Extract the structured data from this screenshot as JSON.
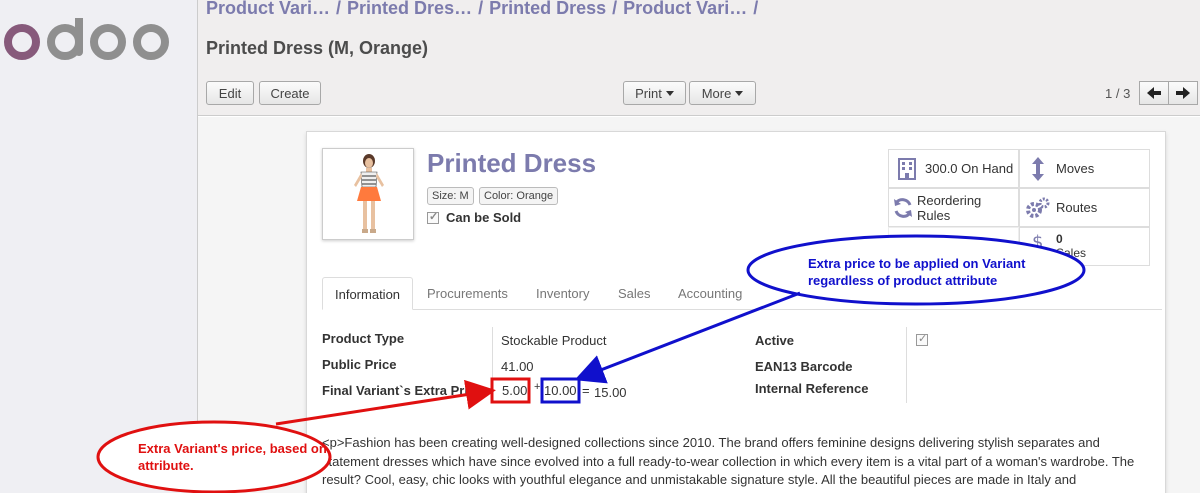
{
  "breadcrumb": [
    "Product Vari…",
    "Printed Dres…",
    "Printed Dress",
    "Product Vari…"
  ],
  "page_title": "Printed Dress (M, Orange)",
  "buttons": {
    "edit": "Edit",
    "create": "Create",
    "print": "Print",
    "more": "More"
  },
  "pager": "1 / 3",
  "product": {
    "name": "Printed Dress",
    "tags": [
      "Size: M",
      "Color: Orange"
    ],
    "can_be_sold": "Can be Sold",
    "can_be_sold_checked": true
  },
  "smart_buttons": {
    "on_hand": "300.0 On Hand",
    "moves": "Moves",
    "reordering": "Reordering Rules",
    "routes": "Routes",
    "sales_count": "0",
    "sales_label": "Sales"
  },
  "tabs": [
    "Information",
    "Procurements",
    "Inventory",
    "Sales",
    "Accounting"
  ],
  "fields": {
    "product_type_label": "Product Type",
    "product_type": "Stockable Product",
    "public_price_label": "Public Price",
    "public_price": "41.00",
    "extra_price_label": "Final Variant`s Extra Price",
    "attr_extra": "5.00",
    "plus": "+",
    "variant_extra": "10.00",
    "equals": "=",
    "total_extra": "15.00",
    "active_label": "Active",
    "active_checked": true,
    "ean_label": "EAN13 Barcode",
    "internal_ref_label": "Internal Reference"
  },
  "description": "<p>Fashion has been creating well-designed collections since 2010. The brand offers feminine designs delivering stylish separates and statement dresses which have since evolved into a full ready-to-wear collection in which every item is a vital part of a woman's wardrobe. The result? Cool, easy, chic looks with youthful elegance and unmistakable signature style. All the beautiful pieces are made in Italy and manufactured with the greatest attention. Now Fashion extends to a range of accessories including shoes, hats, belts and more!</p>",
  "annotations": {
    "blue_callout": "Extra price to be applied on Variant regardless of product attribute",
    "red_callout": "Extra Variant's price, based on attribute.",
    "blue_color": "#1010cc",
    "red_color": "#e01010"
  },
  "colors": {
    "brand": "#7c7bad",
    "logo_o": "#875a7b",
    "logo_grey": "#8f8f8f"
  }
}
